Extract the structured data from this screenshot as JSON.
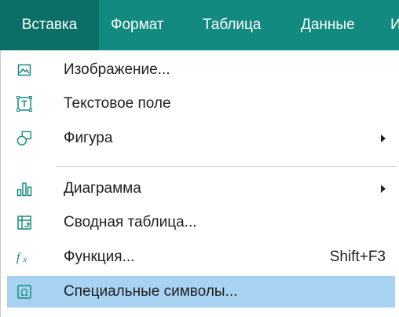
{
  "menubar": {
    "items": [
      {
        "label": "Вставка",
        "active": true
      },
      {
        "label": "Формат",
        "active": false
      },
      {
        "label": "Таблица",
        "active": false
      },
      {
        "label": "Данные",
        "active": false
      },
      {
        "label": "И",
        "active": false
      }
    ]
  },
  "menu": {
    "items": [
      {
        "label": "Изображение...",
        "icon": "image-icon",
        "submenu": false,
        "shortcut": ""
      },
      {
        "label": "Текстовое поле",
        "icon": "text-box-icon",
        "submenu": false,
        "shortcut": ""
      },
      {
        "label": "Фигура",
        "icon": "shape-icon",
        "submenu": true,
        "shortcut": ""
      },
      {
        "label": "Диаграмма",
        "icon": "chart-icon",
        "submenu": true,
        "shortcut": ""
      },
      {
        "label": "Сводная таблица...",
        "icon": "pivot-table-icon",
        "submenu": false,
        "shortcut": ""
      },
      {
        "label": "Функция...",
        "icon": "function-icon",
        "submenu": false,
        "shortcut": "Shift+F3"
      },
      {
        "label": "Специальные символы...",
        "icon": "omega-symbol-icon",
        "submenu": false,
        "shortcut": "",
        "highlighted": true
      }
    ]
  },
  "colors": {
    "menubar_bg": "#128a7f",
    "menubar_active": "#0b6f67",
    "icon_accent": "#128a7f",
    "highlight": "#a8d2f2"
  }
}
